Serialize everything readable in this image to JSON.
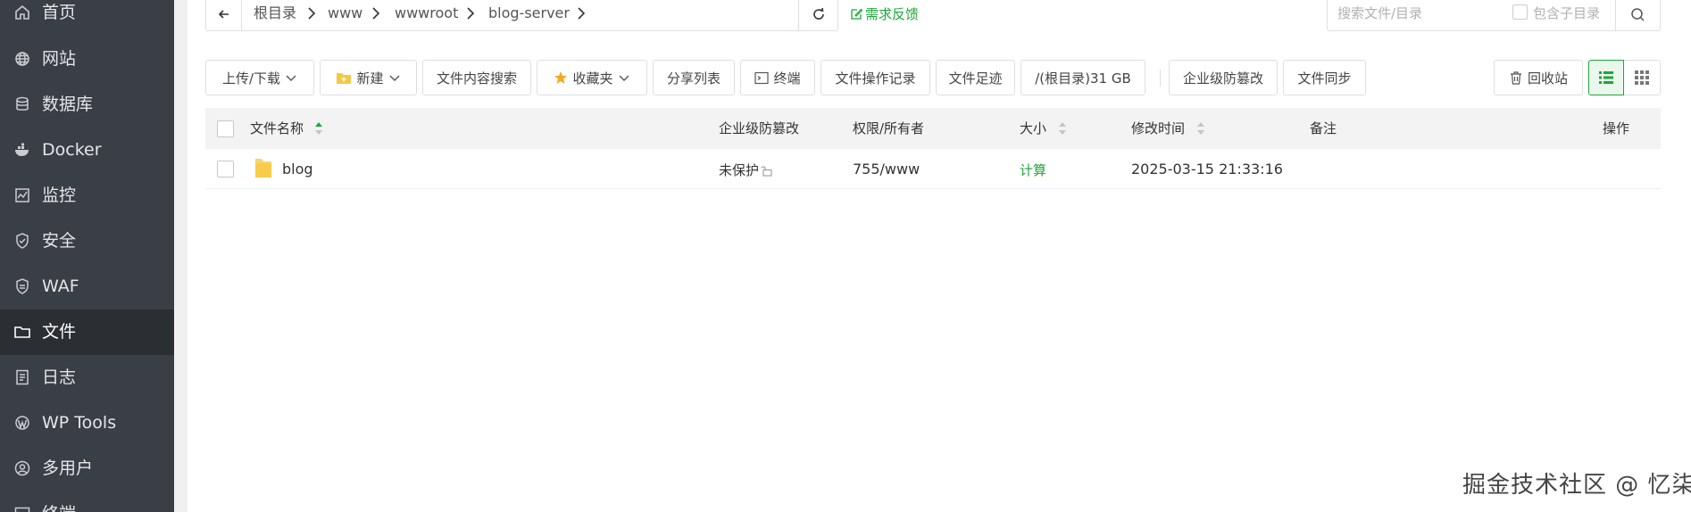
{
  "sidebar": {
    "items": [
      {
        "label": "首页",
        "icon": "home-icon",
        "active": false
      },
      {
        "label": "网站",
        "icon": "globe-icon",
        "active": false
      },
      {
        "label": "数据库",
        "icon": "database-icon",
        "active": false
      },
      {
        "label": "Docker",
        "icon": "docker-icon",
        "active": false
      },
      {
        "label": "监控",
        "icon": "monitor-icon",
        "active": false
      },
      {
        "label": "安全",
        "icon": "shield-icon",
        "active": false
      },
      {
        "label": "WAF",
        "icon": "waf-shield-icon",
        "active": false
      },
      {
        "label": "文件",
        "icon": "folder-icon",
        "active": true
      },
      {
        "label": "日志",
        "icon": "log-icon",
        "active": false
      },
      {
        "label": "WP Tools",
        "icon": "wordpress-icon",
        "active": false
      },
      {
        "label": "多用户",
        "icon": "users-icon",
        "active": false
      },
      {
        "label": "终端",
        "icon": "terminal-icon",
        "active": false
      }
    ]
  },
  "pathbar": {
    "crumbs": [
      "根目录",
      "www",
      "wwwroot",
      "blog-server"
    ]
  },
  "feedback_label": "需求反馈",
  "search": {
    "placeholder": "搜索文件/目录",
    "subdir_label": "包含子目录"
  },
  "toolbar": {
    "upload_download": "上传/下载",
    "new": "新建",
    "content_search": "文件内容搜索",
    "favorites": "收藏夹",
    "share_list": "分享列表",
    "terminal": "终端",
    "operation_log": "文件操作记录",
    "footprint": "文件足迹",
    "disk_usage": "/(根目录)31 GB",
    "tamper_protection": "企业级防篡改",
    "file_sync": "文件同步",
    "recycle_bin": "回收站"
  },
  "table": {
    "columns": {
      "name": "文件名称",
      "tamper": "企业级防篡改",
      "perm": "权限/所有者",
      "size": "大小",
      "mtime": "修改时间",
      "remark": "备注",
      "ops": "操作"
    },
    "rows": [
      {
        "name": "blog",
        "tamper": "未保护",
        "perm": "755/www",
        "size": "计算",
        "mtime": "2025-03-15 21:33:16",
        "remark": ""
      }
    ]
  },
  "watermark": "掘金技术社区 @ 忆柒",
  "colors": {
    "accent": "#20a53a",
    "sidebar_bg": "#3a3e45",
    "sidebar_active_bg": "#2b2f34"
  }
}
